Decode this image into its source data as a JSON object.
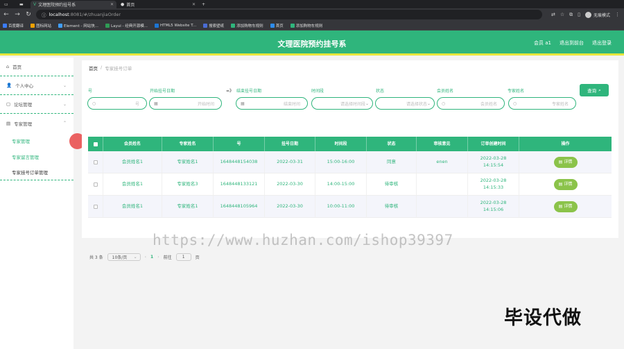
{
  "browser": {
    "tabs": [
      {
        "title": "文理医院预约挂号系",
        "active": true
      },
      {
        "title": "首页",
        "active": false
      }
    ],
    "address": {
      "host": "localhost",
      "path": ":8081/#/zhuanjiaOrder"
    },
    "profile": "无痕模式",
    "bookmarks": [
      "百度翻译",
      "图标网站",
      "Element - 网站快...",
      "Layui - 经典开源模...",
      "HTML5 Website T...",
      "搜索壁纸",
      "添加购物车规则",
      "首页",
      "添加购物车规则"
    ]
  },
  "header": {
    "title": "文理医院预约挂号系",
    "user": "会员 a1",
    "back_label": "退出到前台",
    "logout_label": "退出登录"
  },
  "sidebar": {
    "items": [
      {
        "label": "首页",
        "icon": "home-icon"
      },
      {
        "label": "个人中心",
        "icon": "user-icon"
      },
      {
        "label": "论坛管理",
        "icon": "forum-icon"
      },
      {
        "label": "专家管理",
        "icon": "doctor-icon"
      }
    ],
    "subitems": [
      "专家管理",
      "专家留言管理",
      "专家挂号订单管理"
    ]
  },
  "breadcrumb": {
    "home": "首页",
    "current": "专家挂号订单"
  },
  "filters": {
    "labels": [
      "号",
      "开始挂号日期",
      "结束挂号日期",
      "时间段",
      "状态",
      "会员姓名",
      "专家姓名"
    ],
    "arrow": "=》",
    "placeholders": [
      "号",
      "开始时间",
      "结束时间",
      "请选择时间段",
      "请选择状态",
      "会员姓名",
      "专家姓名"
    ],
    "search_label": "查询"
  },
  "table": {
    "columns": [
      "会员姓名",
      "专家姓名",
      "号",
      "挂号日期",
      "时间段",
      "状态",
      "审核意见",
      "订单创建时间",
      "操作"
    ],
    "rows": [
      [
        "会员姓名1",
        "专家姓名1",
        "1648448154038",
        "2022-03-31",
        "15:00-16:00",
        "同意",
        "enen",
        "2022-03-28 14:15:54"
      ],
      [
        "会员姓名1",
        "专家姓名3",
        "1648448133121",
        "2022-03-30",
        "14:00-15:00",
        "待审核",
        "",
        "2022-03-28 14:15:33"
      ],
      [
        "会员姓名1",
        "专家姓名1",
        "1648448105964",
        "2022-03-30",
        "10:00-11:00",
        "待审核",
        "",
        "2022-03-28 14:15:06"
      ]
    ],
    "detail_label": "详情"
  },
  "pager": {
    "total": "共 3 条",
    "size": "10条/页",
    "page": "1",
    "goto": "前往",
    "goto_value": "1",
    "unit": "页"
  },
  "overlay": {
    "watermark": "https://www.huzhan.com/ishop39397",
    "stamp": "毕设代做"
  }
}
